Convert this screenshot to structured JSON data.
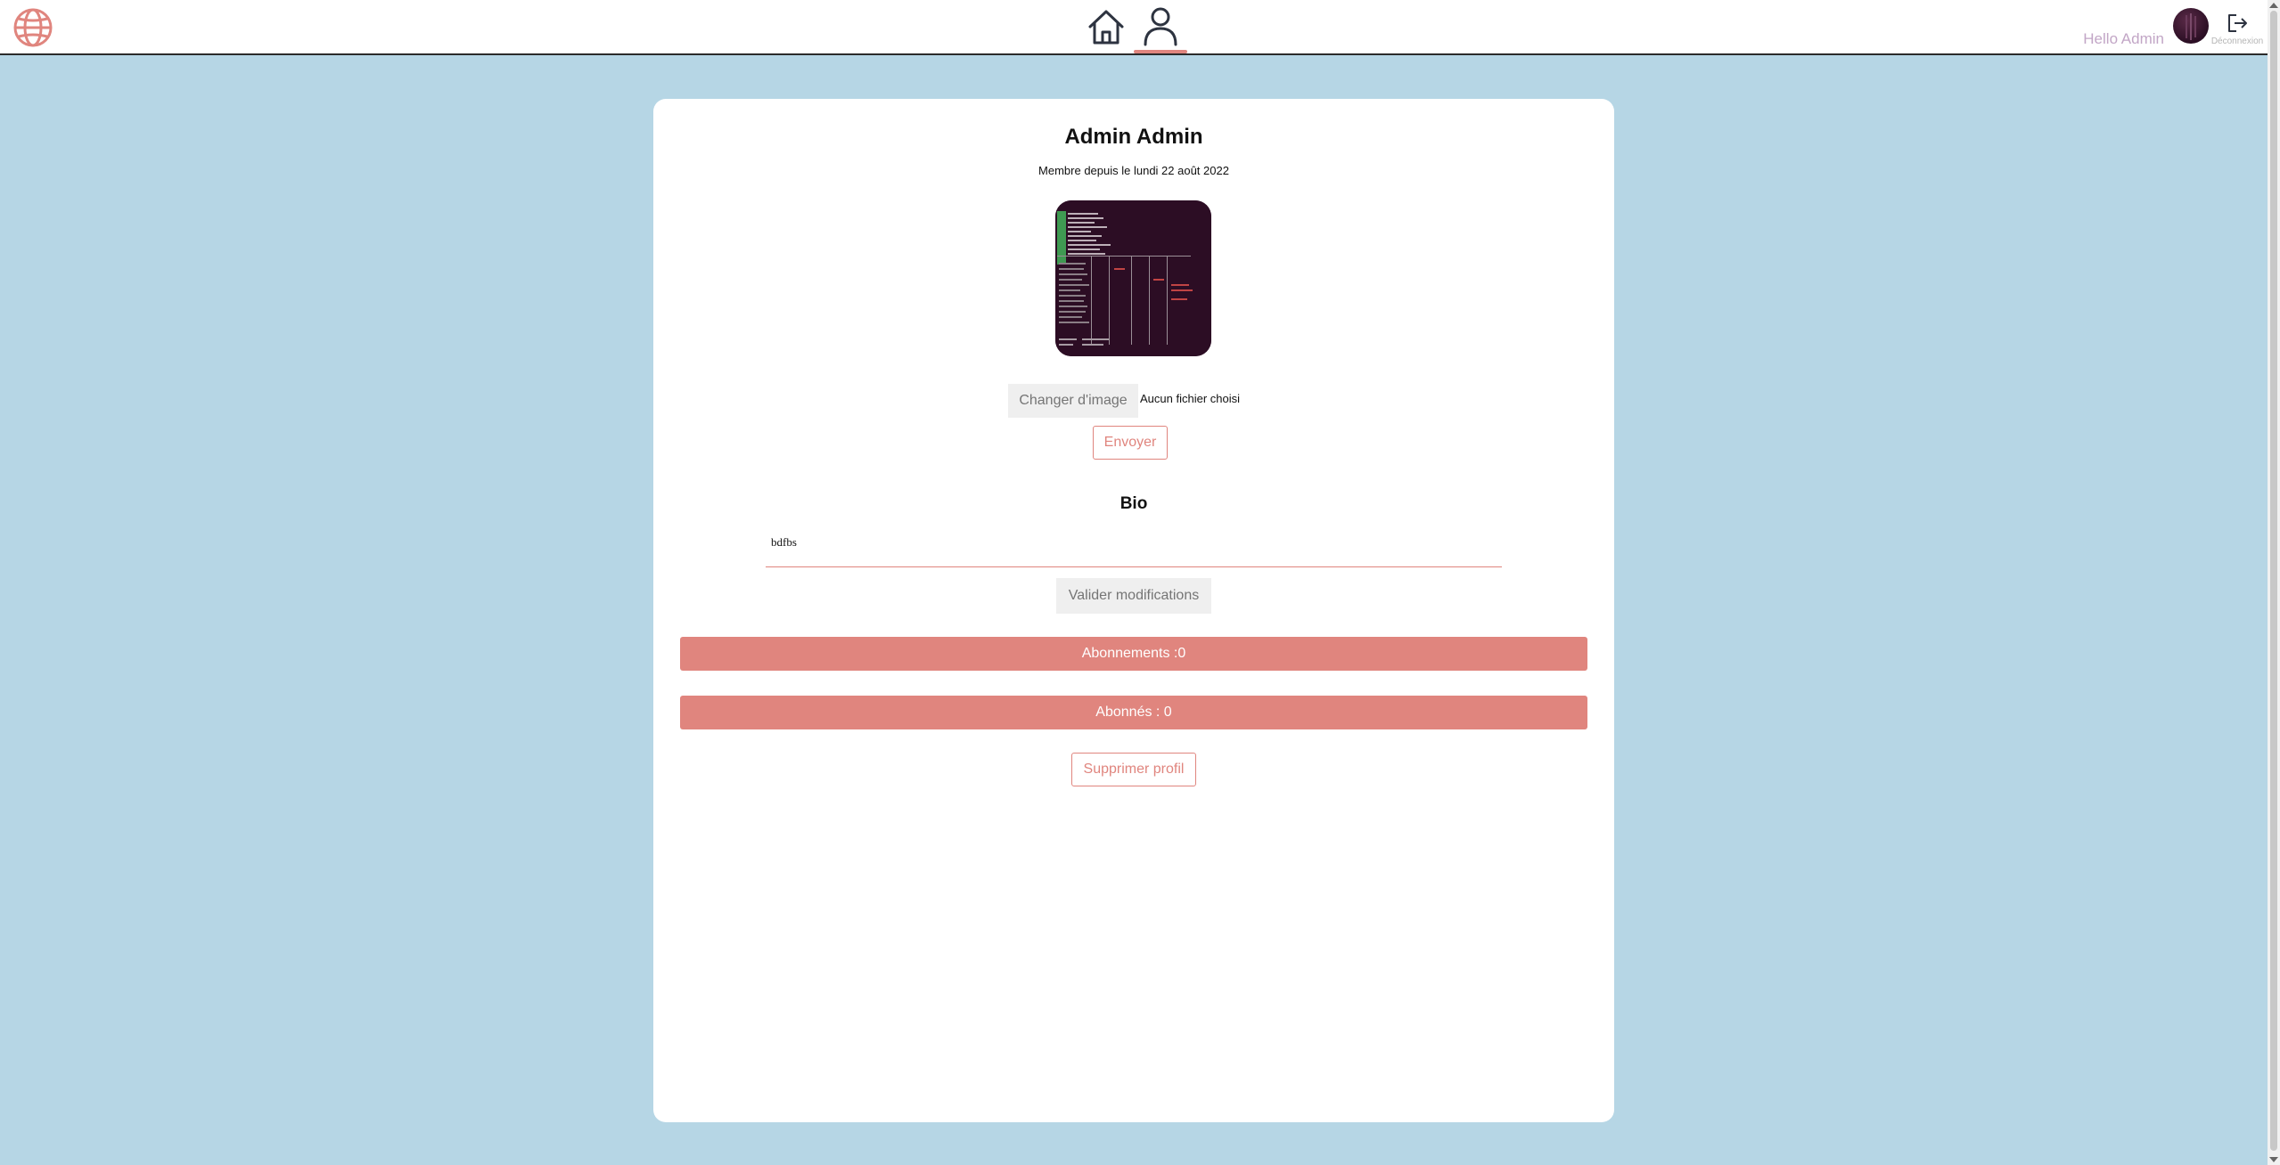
{
  "header": {
    "greeting": "Hello Admin",
    "logout_label": "Déconnexion",
    "icons": {
      "logo": "globe-icon",
      "home": "home-icon",
      "profile": "user-icon",
      "logout": "logout-icon"
    },
    "active_tab": "profile"
  },
  "profile": {
    "name": "Admin Admin",
    "member_since": "Membre depuis le lundi 22 août 2022",
    "change_image_label": "Changer d'image",
    "no_file_label": "Aucun fichier choisi",
    "send_label": "Envoyer"
  },
  "bio": {
    "title": "Bio",
    "value": "bdfbs",
    "validate_label": "Valider modifications"
  },
  "stats": {
    "subscriptions_label": "Abonnements :0",
    "followers_label": "Abonnés : 0"
  },
  "actions": {
    "delete_label": "Supprimer profil"
  },
  "colors": {
    "accent": "#e0857e",
    "background": "#b6d6e5",
    "card": "#ffffff",
    "greeting": "#c2a6c6"
  }
}
